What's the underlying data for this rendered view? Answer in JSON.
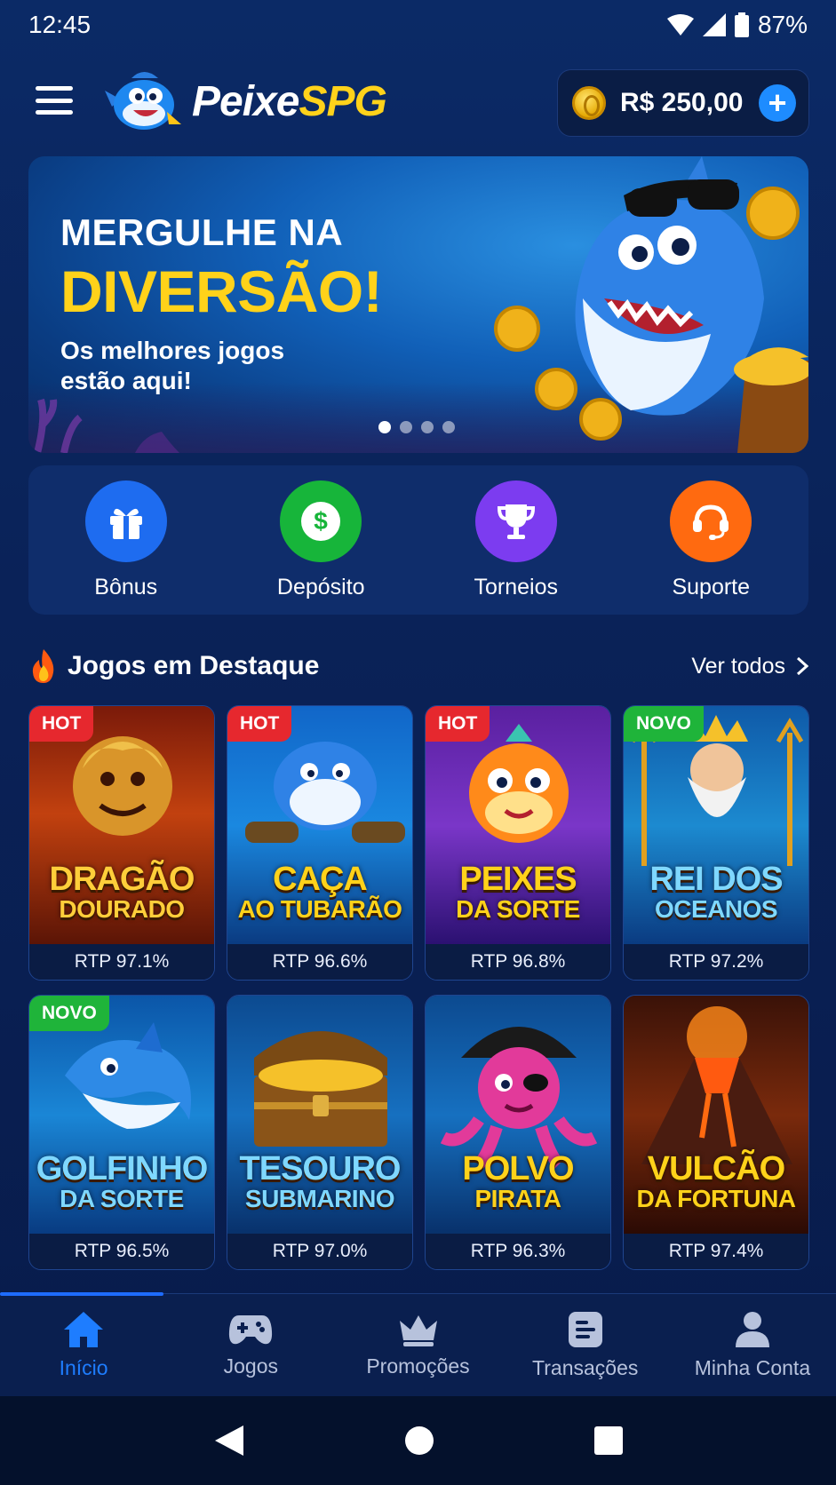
{
  "status_bar": {
    "time": "12:45",
    "battery": "87%"
  },
  "header": {
    "logo_part1": "Peixe",
    "logo_part2": "SPG",
    "balance": "R$ 250,00"
  },
  "banner": {
    "title_line1": "MERGULHE NA",
    "title_line2": "DIVERSÃO!",
    "subtitle": "Os melhores jogos estão aqui!",
    "slides": 4,
    "active_slide": 1
  },
  "quick_actions": [
    {
      "label": "Bônus",
      "icon": "gift-icon",
      "color": "#1e6cf0"
    },
    {
      "label": "Depósito",
      "icon": "dollar-icon",
      "color": "#17b53a"
    },
    {
      "label": "Torneios",
      "icon": "trophy-icon",
      "color": "#7c3cf0"
    },
    {
      "label": "Suporte",
      "icon": "headset-icon",
      "color": "#ff6a10"
    }
  ],
  "featured": {
    "title": "Jogos em Destaque",
    "see_all": "Ver todos",
    "games": [
      {
        "line1": "DRAGÃO",
        "line2": "DOURADO",
        "rtp": "RTP 97.1%",
        "badge": "HOT",
        "badge_color": "#e6282e",
        "theme": "dragon"
      },
      {
        "line1": "CAÇA",
        "line2": "AO TUBARÃO",
        "rtp": "RTP 96.6%",
        "badge": "HOT",
        "badge_color": "#e6282e",
        "theme": "shark"
      },
      {
        "line1": "PEIXES",
        "line2": "DA SORTE",
        "rtp": "RTP 96.8%",
        "badge": "HOT",
        "badge_color": "#e6282e",
        "theme": "puffer"
      },
      {
        "line1": "REI DOS",
        "line2": "OCEANOS",
        "rtp": "RTP 97.2%",
        "badge": "NOVO",
        "badge_color": "#1fb43a",
        "theme": "king"
      },
      {
        "line1": "GOLFINHO",
        "line2": "DA SORTE",
        "rtp": "RTP 96.5%",
        "badge": "NOVO",
        "badge_color": "#1fb43a",
        "theme": "dolphin"
      },
      {
        "line1": "TESOURO",
        "line2": "SUBMARINO",
        "rtp": "RTP 97.0%",
        "badge": "",
        "badge_color": "",
        "theme": "treasure"
      },
      {
        "line1": "POLVO",
        "line2": "PIRATA",
        "rtp": "RTP 96.3%",
        "badge": "",
        "badge_color": "",
        "theme": "octopus"
      },
      {
        "line1": "VULCÃO",
        "line2": "DA FORTUNA",
        "rtp": "RTP 97.4%",
        "badge": "",
        "badge_color": "",
        "theme": "volcano"
      }
    ]
  },
  "bottom_nav": [
    {
      "label": "Início",
      "icon": "home-icon",
      "active": true
    },
    {
      "label": "Jogos",
      "icon": "gamepad-icon",
      "active": false
    },
    {
      "label": "Promoções",
      "icon": "crown-icon",
      "active": false
    },
    {
      "label": "Transações",
      "icon": "receipt-icon",
      "active": false
    },
    {
      "label": "Minha Conta",
      "icon": "user-icon",
      "active": false
    }
  ]
}
